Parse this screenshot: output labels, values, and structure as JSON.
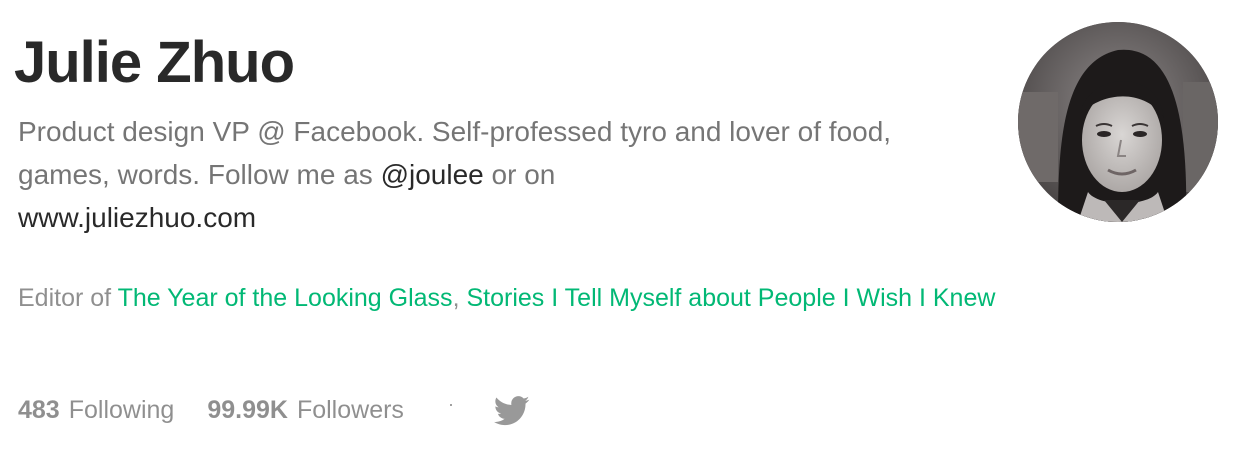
{
  "profile": {
    "name": "Julie Zhuo",
    "bio_text": "Product design VP @ Facebook. Self-professed tyro and lover of food, games, words. Follow me as ",
    "bio_handle": "@joulee",
    "bio_or": " or on ",
    "bio_website": "www.juliezhuo.com",
    "editor_prefix": "Editor of ",
    "publications": [
      "The Year of the Looking Glass",
      "Stories I Tell Myself about People I Wish I Knew"
    ],
    "publication_separator": ", ",
    "following_count": "483",
    "following_label": "Following",
    "followers_count": "99.99K",
    "followers_label": "Followers",
    "stats_separator": "·",
    "social_icon": "twitter-icon"
  },
  "colors": {
    "accent_green": "#02b875",
    "twitter_gray": "#999999"
  }
}
